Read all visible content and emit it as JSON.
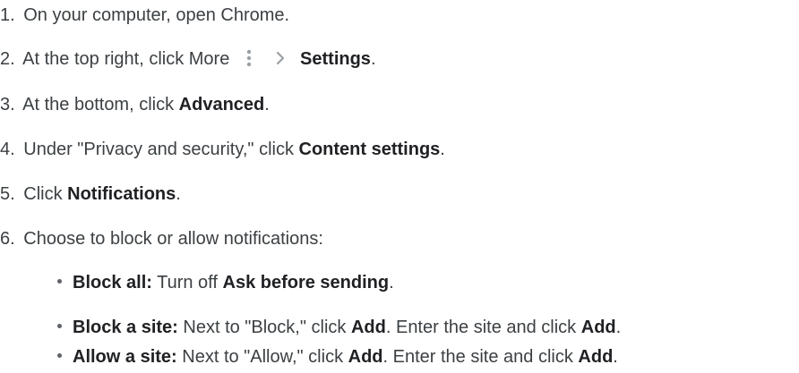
{
  "steps": [
    {
      "num": "1.",
      "text": "On your computer, open Chrome."
    },
    {
      "num": "2.",
      "pre": "At the top right, click More",
      "more_icon": "more-vert-icon",
      "chevron_icon": "chevron-right-icon",
      "bold": "Settings",
      "post": "."
    },
    {
      "num": "3.",
      "pre": "At the bottom, click ",
      "bold": "Advanced",
      "post": "."
    },
    {
      "num": "4.",
      "pre": "Under \"Privacy and security,\" click ",
      "bold": "Content settings",
      "post": "."
    },
    {
      "num": "5.",
      "pre": "Click ",
      "bold": "Notifications",
      "post": "."
    },
    {
      "num": "6.",
      "text": "Choose to block or allow notifications:"
    }
  ],
  "substeps": [
    {
      "label": "Block all:",
      "t1": " Turn off ",
      "b1": "Ask before sending",
      "t2": ".",
      "b2": "",
      "t3": ""
    },
    {
      "label": "Block a site:",
      "t1": " Next to \"Block,\" click ",
      "b1": "Add",
      "t2": ". Enter the site and click ",
      "b2": "Add",
      "t3": "."
    },
    {
      "label": "Allow a site:",
      "t1": " Next to \"Allow,\" click ",
      "b1": "Add",
      "t2": ". Enter the site and click ",
      "b2": "Add",
      "t3": "."
    }
  ],
  "colors": {
    "text": "#3c4043",
    "bold": "#202124",
    "icon": "#9aa0a6"
  }
}
